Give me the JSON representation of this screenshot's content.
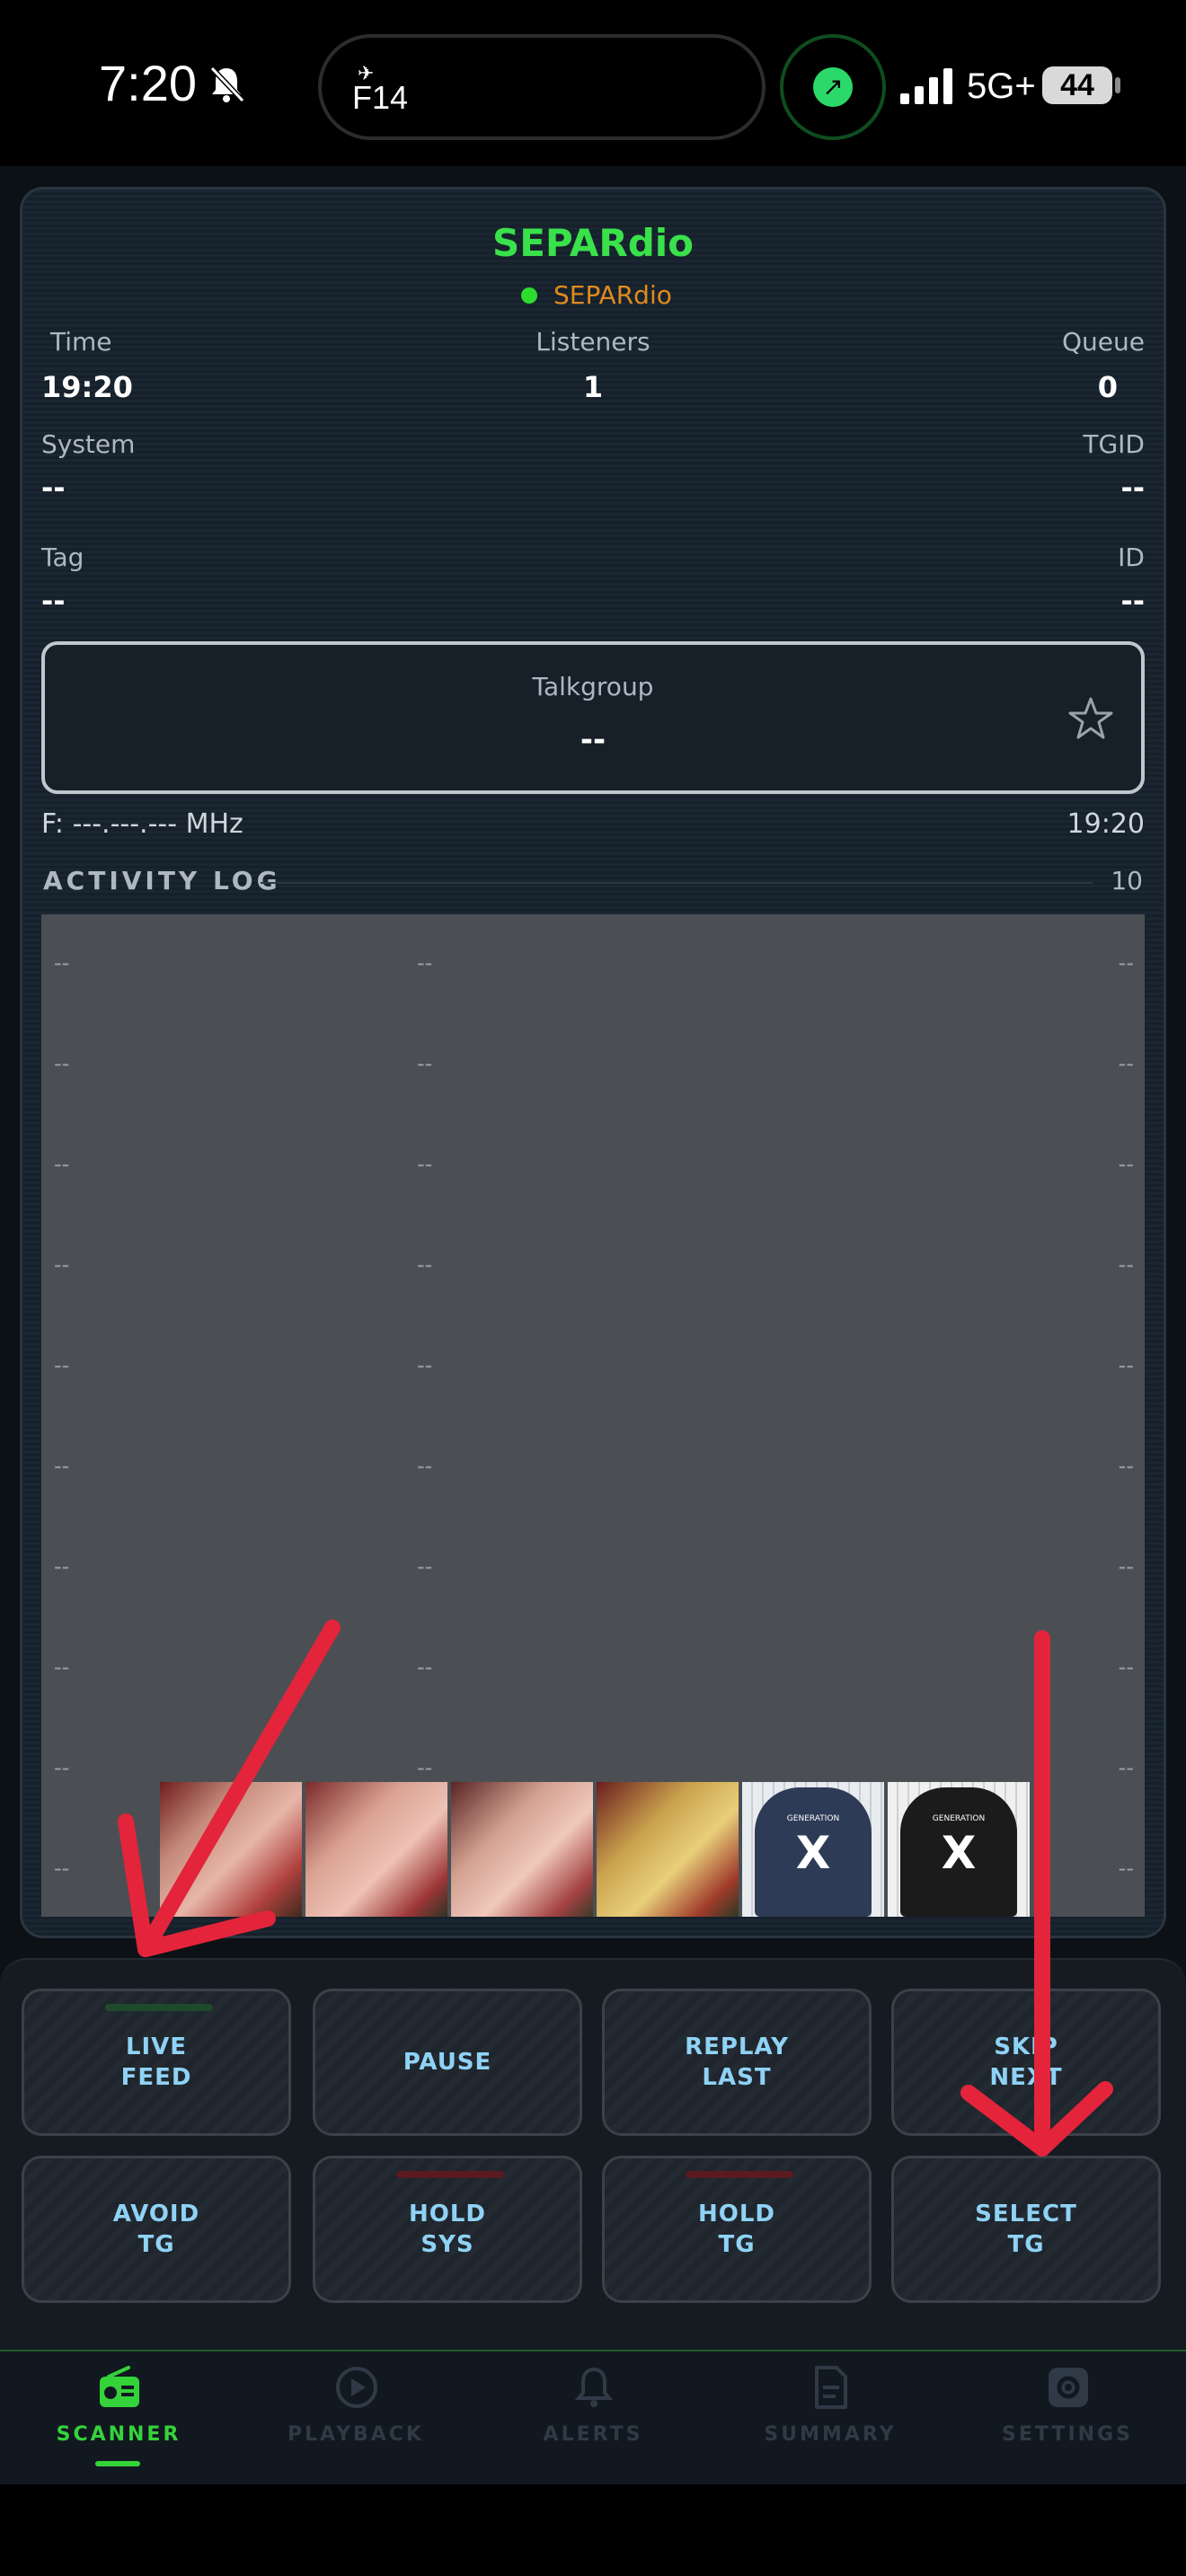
{
  "status_bar": {
    "time": "7:20",
    "flight_code": "F14",
    "network": "5G+",
    "battery": "44"
  },
  "station": {
    "title": "SEPARdio",
    "status": "SEPARdio"
  },
  "info": {
    "time_label": "Time",
    "time_value": "19:20",
    "listeners_label": "Listeners",
    "listeners_value": "1",
    "queue_label": "Queue",
    "queue_value": "0",
    "system_label": "System",
    "system_value": "--",
    "tgid_label": "TGID",
    "tgid_value": "--",
    "tag_label": "Tag",
    "tag_value": "--",
    "id_label": "ID",
    "id_value": "--"
  },
  "talkgroup": {
    "label": "Talkgroup",
    "value": "--"
  },
  "frequency": {
    "text": "F: ---.---.--- MHz",
    "time": "19:20"
  },
  "activity_log": {
    "title": "ACTIVITY LOG",
    "count": "10",
    "rows": [
      {
        "a": "--",
        "b": "--",
        "c": "--"
      },
      {
        "a": "--",
        "b": "--",
        "c": "--"
      },
      {
        "a": "--",
        "b": "--",
        "c": "--"
      },
      {
        "a": "--",
        "b": "--",
        "c": "--"
      },
      {
        "a": "--",
        "b": "--",
        "c": "--"
      },
      {
        "a": "--",
        "b": "--",
        "c": "--"
      },
      {
        "a": "--",
        "b": "--",
        "c": "--"
      },
      {
        "a": "--",
        "b": "--",
        "c": "--"
      },
      {
        "a": "--",
        "b": "--",
        "c": "--"
      },
      {
        "a": "--",
        "b": "",
        "c": "--"
      }
    ]
  },
  "ads": {
    "hoodie_text": "GENERATION",
    "hoodie_mark": "X"
  },
  "controls": {
    "live_feed": [
      "LIVE",
      "FEED"
    ],
    "pause": [
      "PAUSE"
    ],
    "replay_last": [
      "REPLAY",
      "LAST"
    ],
    "skip_next": [
      "SKIP",
      "NEXT"
    ],
    "avoid_tg": [
      "AVOID",
      "TG"
    ],
    "hold_sys": [
      "HOLD",
      "SYS"
    ],
    "hold_tg": [
      "HOLD",
      "TG"
    ],
    "select_tg": [
      "SELECT",
      "TG"
    ]
  },
  "tabs": {
    "scanner": "SCANNER",
    "playback": "PLAYBACK",
    "alerts": "ALERTS",
    "summary": "SUMMARY",
    "settings": "SETTINGS"
  },
  "colors": {
    "accent_green": "#35d33a",
    "station_orange": "#e08a1e",
    "button_text": "#8fd2f5",
    "annotation_red": "#e3243b"
  },
  "icons": {
    "bell": "bell-slash-icon",
    "star": "star-icon",
    "scanner": "radio-icon",
    "playback": "play-circle-icon",
    "alerts": "bell-icon",
    "summary": "document-icon",
    "settings": "gear-icon"
  }
}
